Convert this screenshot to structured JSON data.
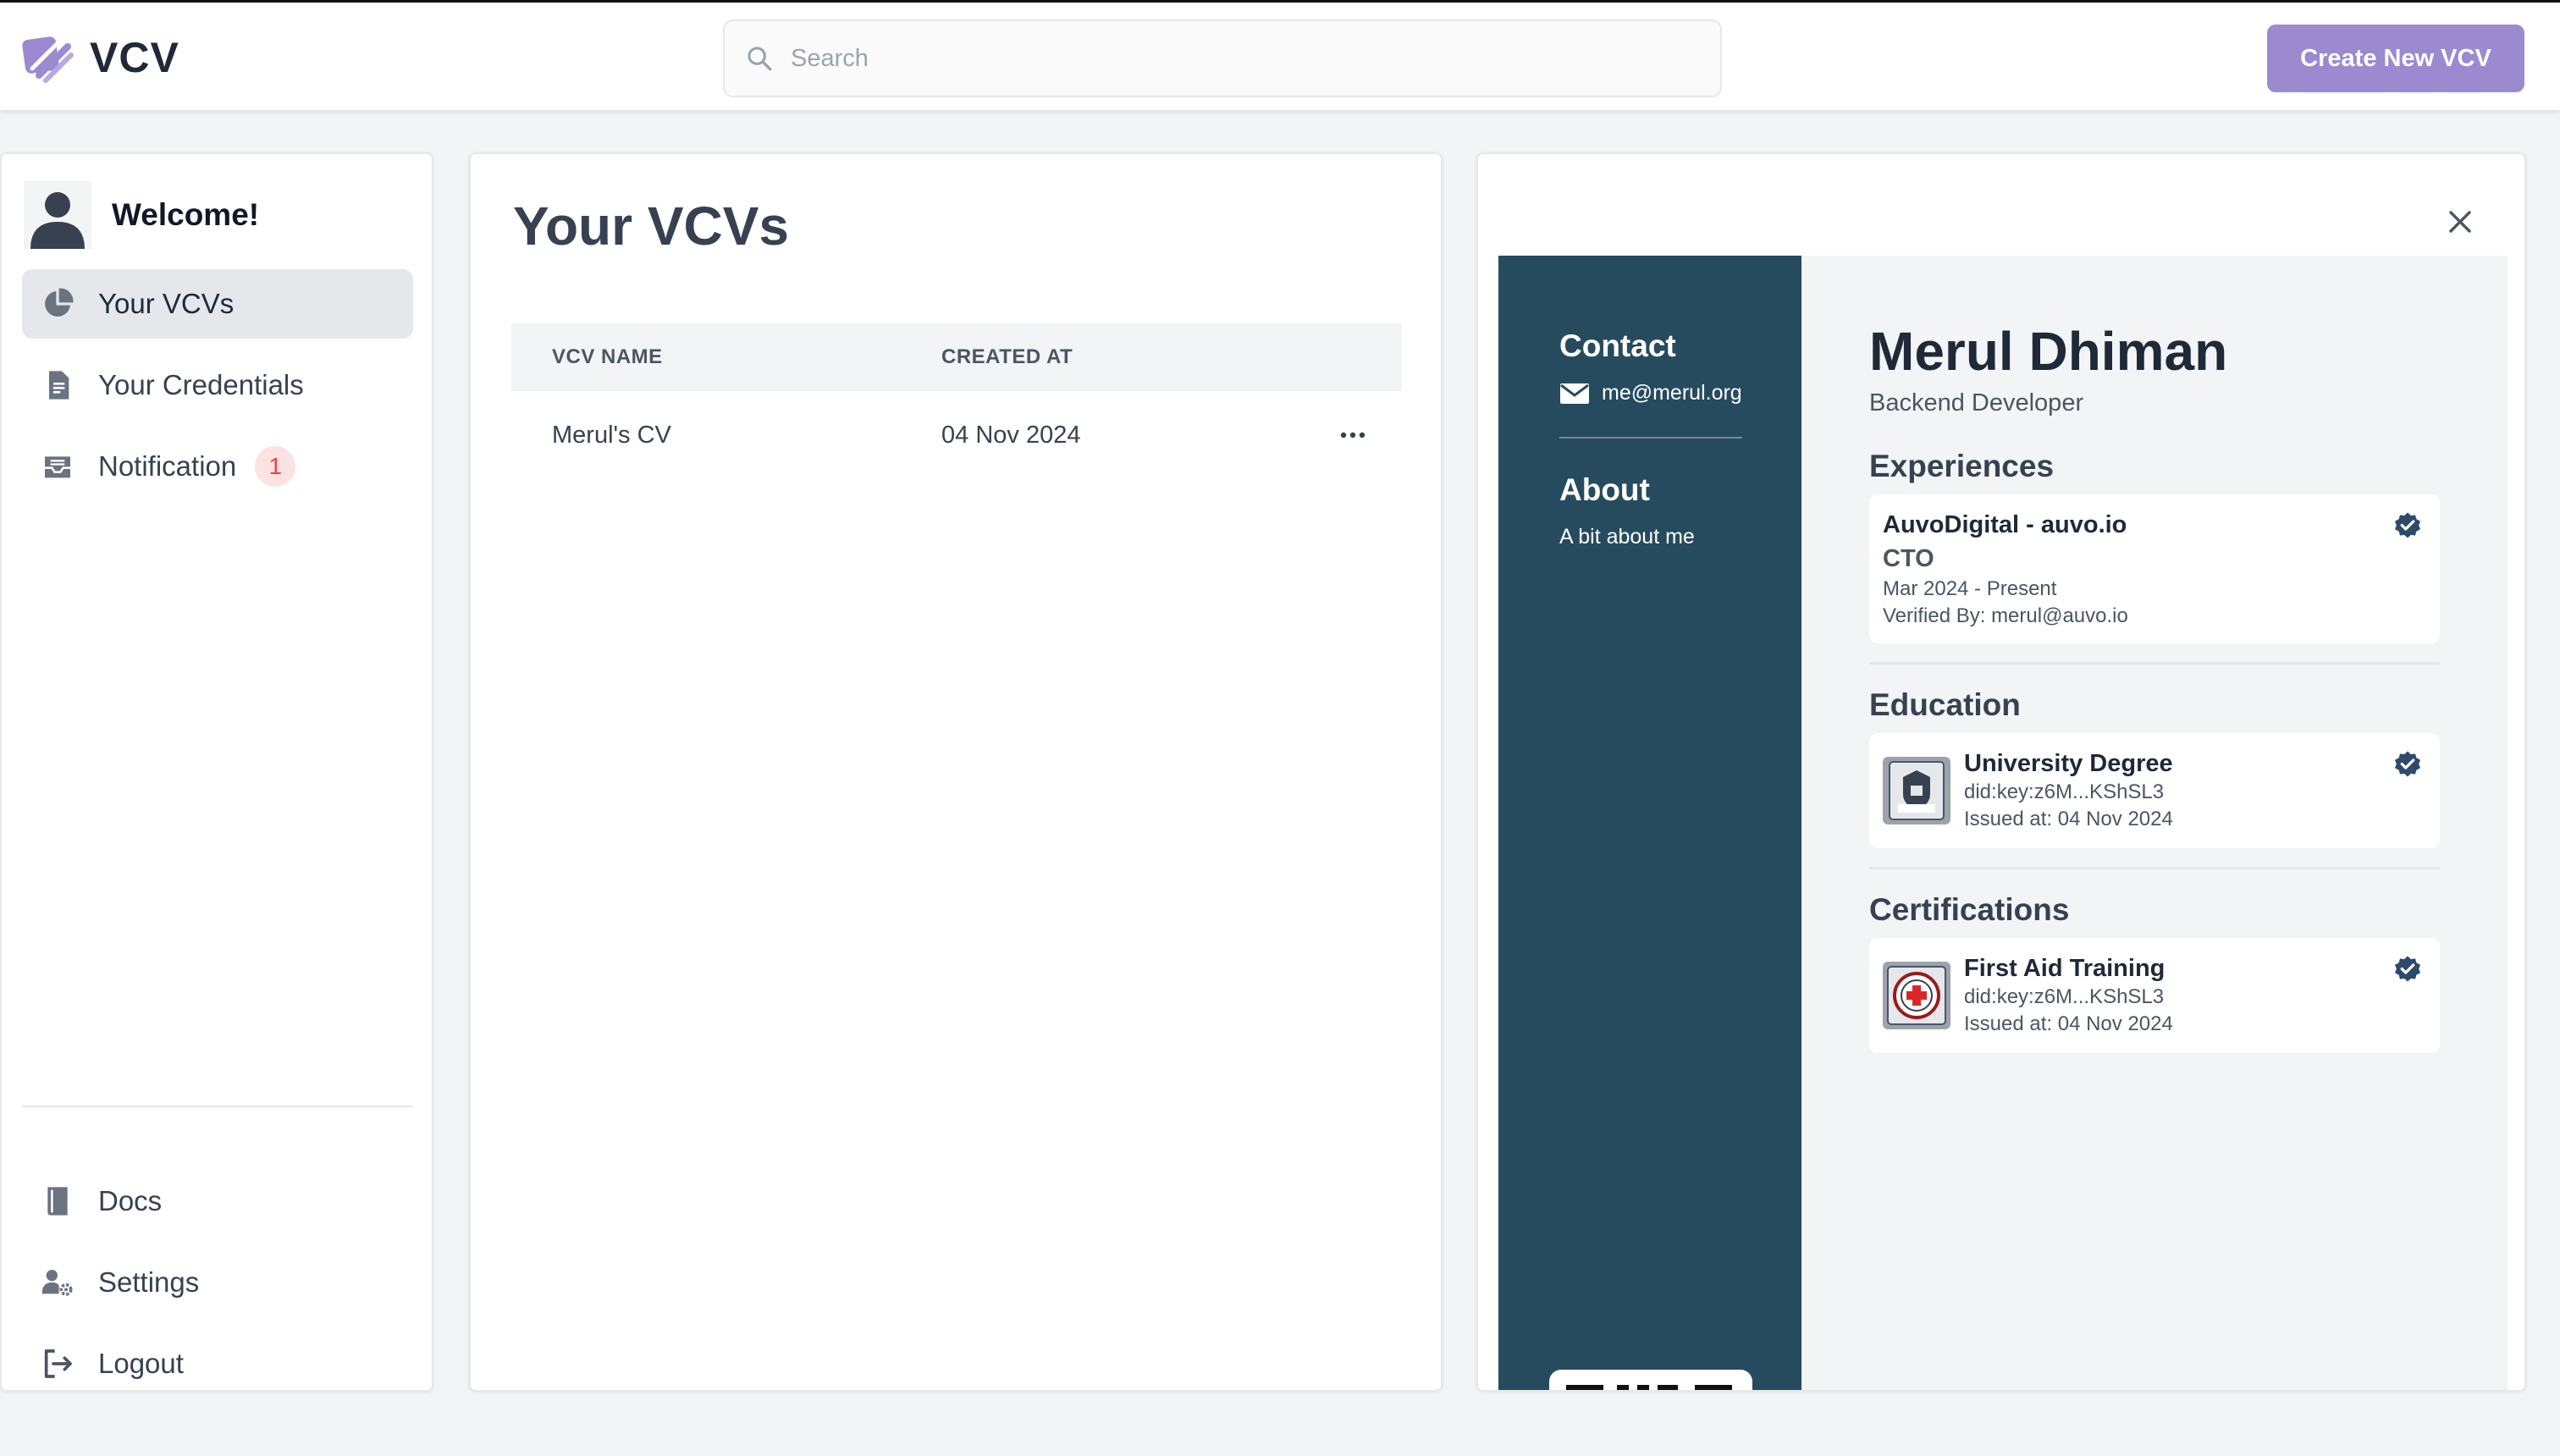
{
  "header": {
    "brand": "VCV",
    "search_placeholder": "Search",
    "create_button": "Create New VCV"
  },
  "sidebar": {
    "welcome": "Welcome!",
    "items": [
      {
        "label": "Your VCVs",
        "icon": "pie-chart-icon",
        "active": true
      },
      {
        "label": "Your Credentials",
        "icon": "document-icon"
      },
      {
        "label": "Notification",
        "icon": "inbox-icon",
        "badge": "1"
      }
    ],
    "bottom_items": [
      {
        "label": "Docs",
        "icon": "book-icon"
      },
      {
        "label": "Settings",
        "icon": "user-gear-icon"
      },
      {
        "label": "Logout",
        "icon": "logout-icon"
      }
    ]
  },
  "vcvs": {
    "title": "Your VCVs",
    "columns": [
      "VCV NAME",
      "CREATED AT"
    ],
    "rows": [
      {
        "name": "Merul's CV",
        "created_at": "04 Nov 2024"
      }
    ]
  },
  "preview": {
    "contact_heading": "Contact",
    "email": "me@merul.org",
    "about_heading": "About",
    "about_text": "A bit about me",
    "name": "Merul Dhiman",
    "role": "Backend Developer",
    "experiences_heading": "Experiences",
    "experience": {
      "org": "AuvoDigital - auvo.io",
      "title": "CTO",
      "dates": "Mar 2024 - Present",
      "verified_by": "Verified By: merul@auvo.io"
    },
    "education_heading": "Education",
    "education": {
      "name": "University Degree",
      "did": "did:key:z6M...KShSL3",
      "issued": "Issued at: 04 Nov 2024"
    },
    "certifications_heading": "Certifications",
    "certification": {
      "name": "First Aid Training",
      "did": "did:key:z6M...KShSL3",
      "issued": "Issued at: 04 Nov 2024"
    }
  },
  "colors": {
    "accent": "#9b8ad0",
    "cv_sidebar": "#274b5e",
    "verified": "#2d4a6b",
    "badge_bg": "#fde2e2",
    "badge_text": "#ef4444"
  }
}
